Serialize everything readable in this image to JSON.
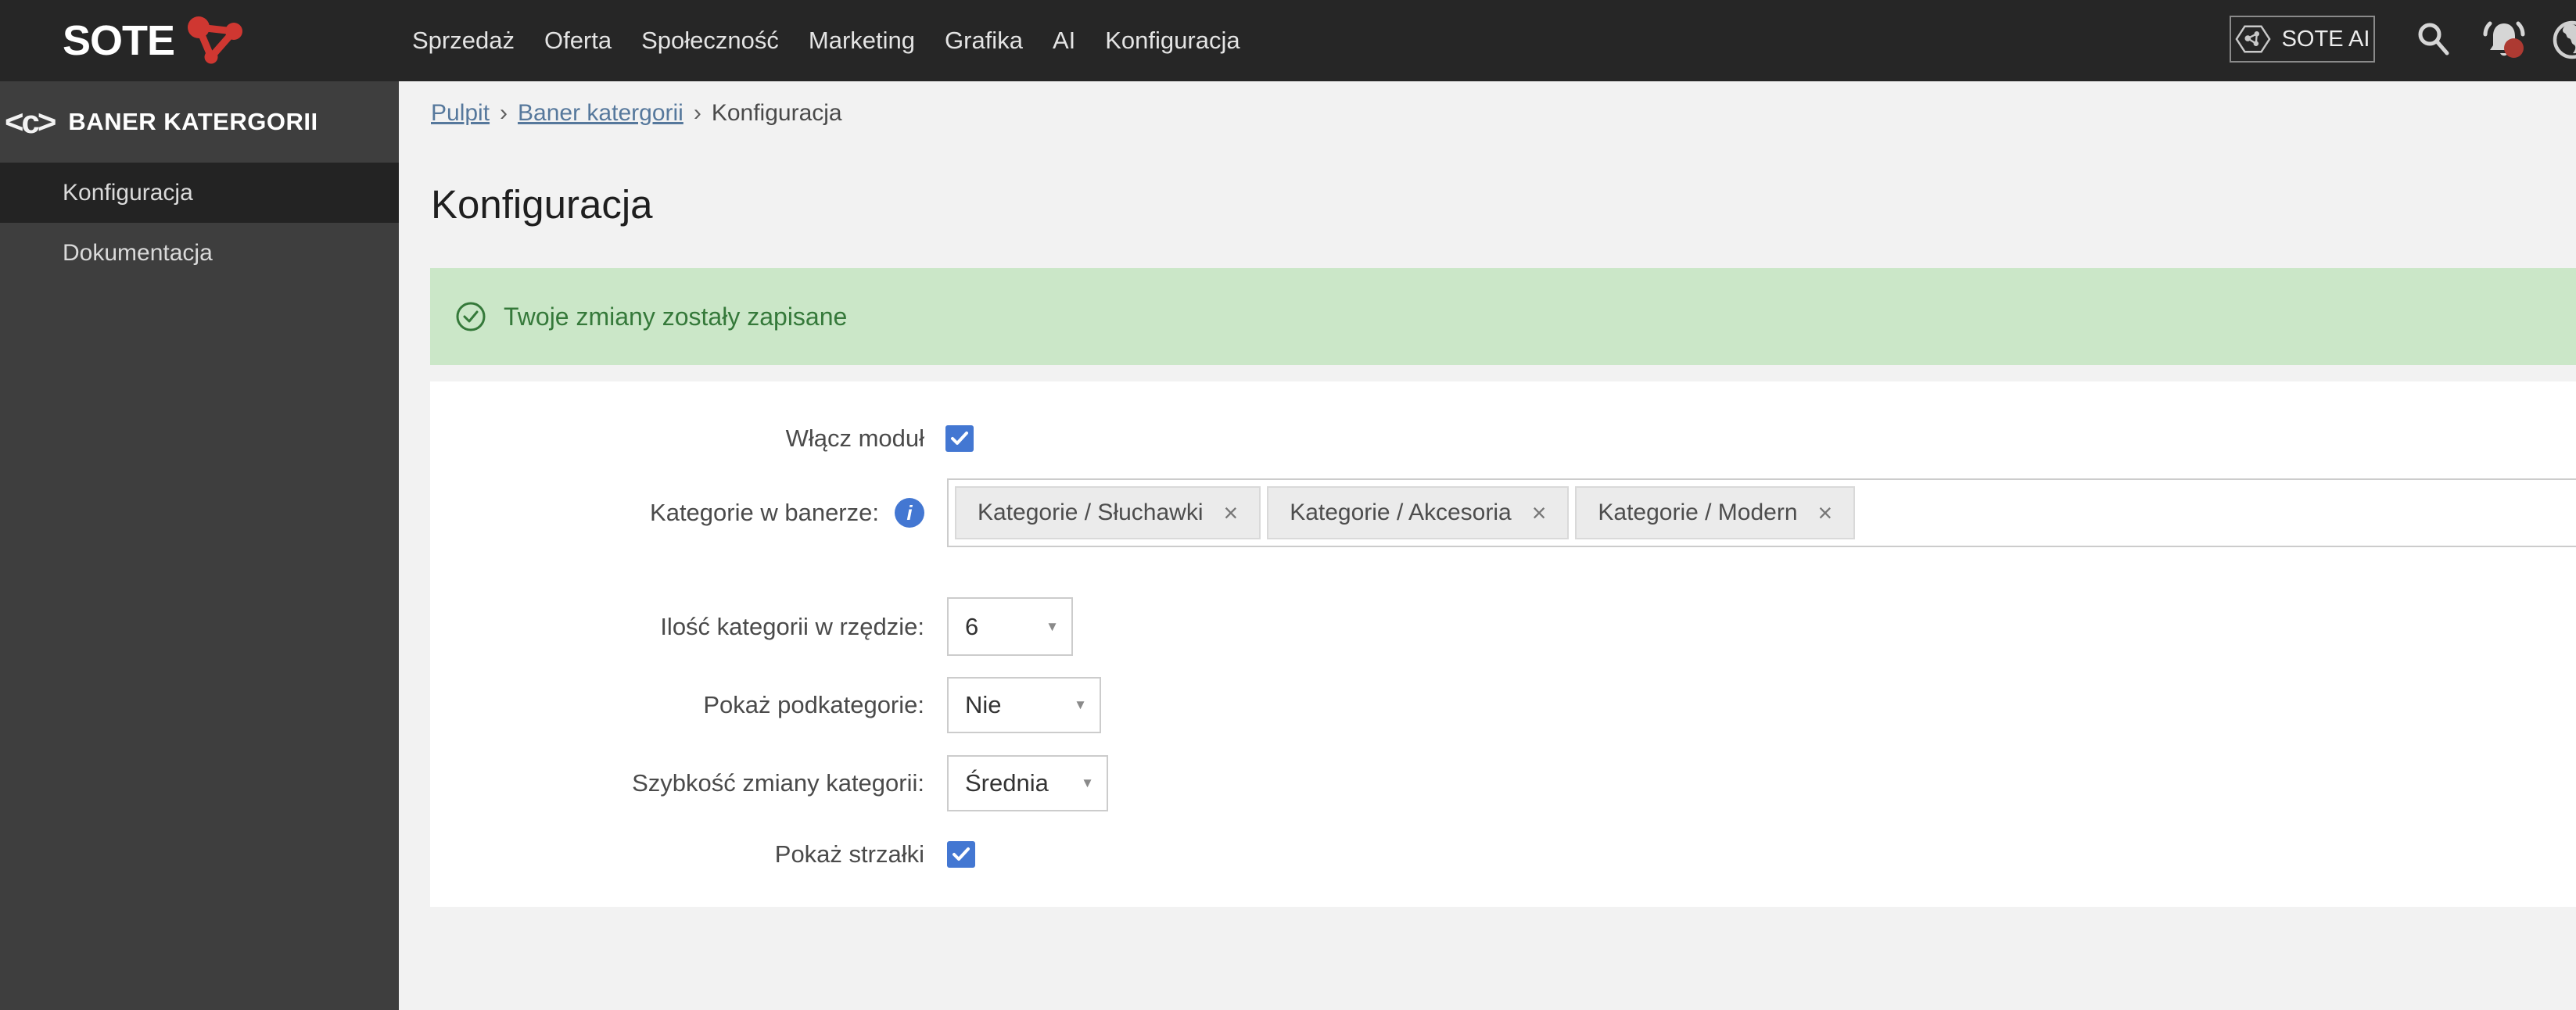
{
  "topbar": {
    "logo_text": "SOTE",
    "menu": [
      "Sprzedaż",
      "Oferta",
      "Społeczność",
      "Marketing",
      "Grafika",
      "AI",
      "Konfiguracja"
    ],
    "sote_ai_label": "SOTE AI"
  },
  "sidebar": {
    "module_icon": "<c>",
    "title": "BANER KATERGORII",
    "items": [
      "Konfiguracja",
      "Dokumentacja"
    ]
  },
  "breadcrumb": {
    "separator": "›",
    "items": [
      "Pulpit",
      "Baner katergorii",
      "Konfiguracja"
    ]
  },
  "page": {
    "title": "Konfiguracja"
  },
  "alert": {
    "message": "Twoje zmiany zostały zapisane"
  },
  "form": {
    "enable": {
      "label": "Włącz moduł",
      "checked": true
    },
    "categories": {
      "label": "Kategorie w banerze:",
      "tags": [
        "Kategorie / Słuchawki",
        "Kategorie / Akcesoria",
        "Kategorie / Modern"
      ],
      "remove_symbol": "×"
    },
    "per_row": {
      "label": "Ilość kategorii w rzędzie:",
      "value": "6"
    },
    "subcats": {
      "label": "Pokaż podkategorie:",
      "value": "Nie"
    },
    "speed": {
      "label": "Szybkość zmiany kategorii:",
      "value": "Średnia"
    },
    "arrows": {
      "label": "Pokaż strzałki",
      "checked": true
    },
    "dropdown_arrow": "▼"
  },
  "colors": {
    "topbar_bg": "#262626",
    "sidebar_bg": "#3e3e3e",
    "sidebar_active_bg": "#232323",
    "page_bg": "#f2f2f2",
    "card_bg": "#ffffff",
    "alert_bg": "#cbe7c8",
    "alert_text": "#35793a",
    "accent_blue": "#4377d2",
    "brand_red": "#cf3731",
    "badge_red": "#ad3a32",
    "link_blue": "#56789c",
    "border_gray": "#cccccc"
  }
}
